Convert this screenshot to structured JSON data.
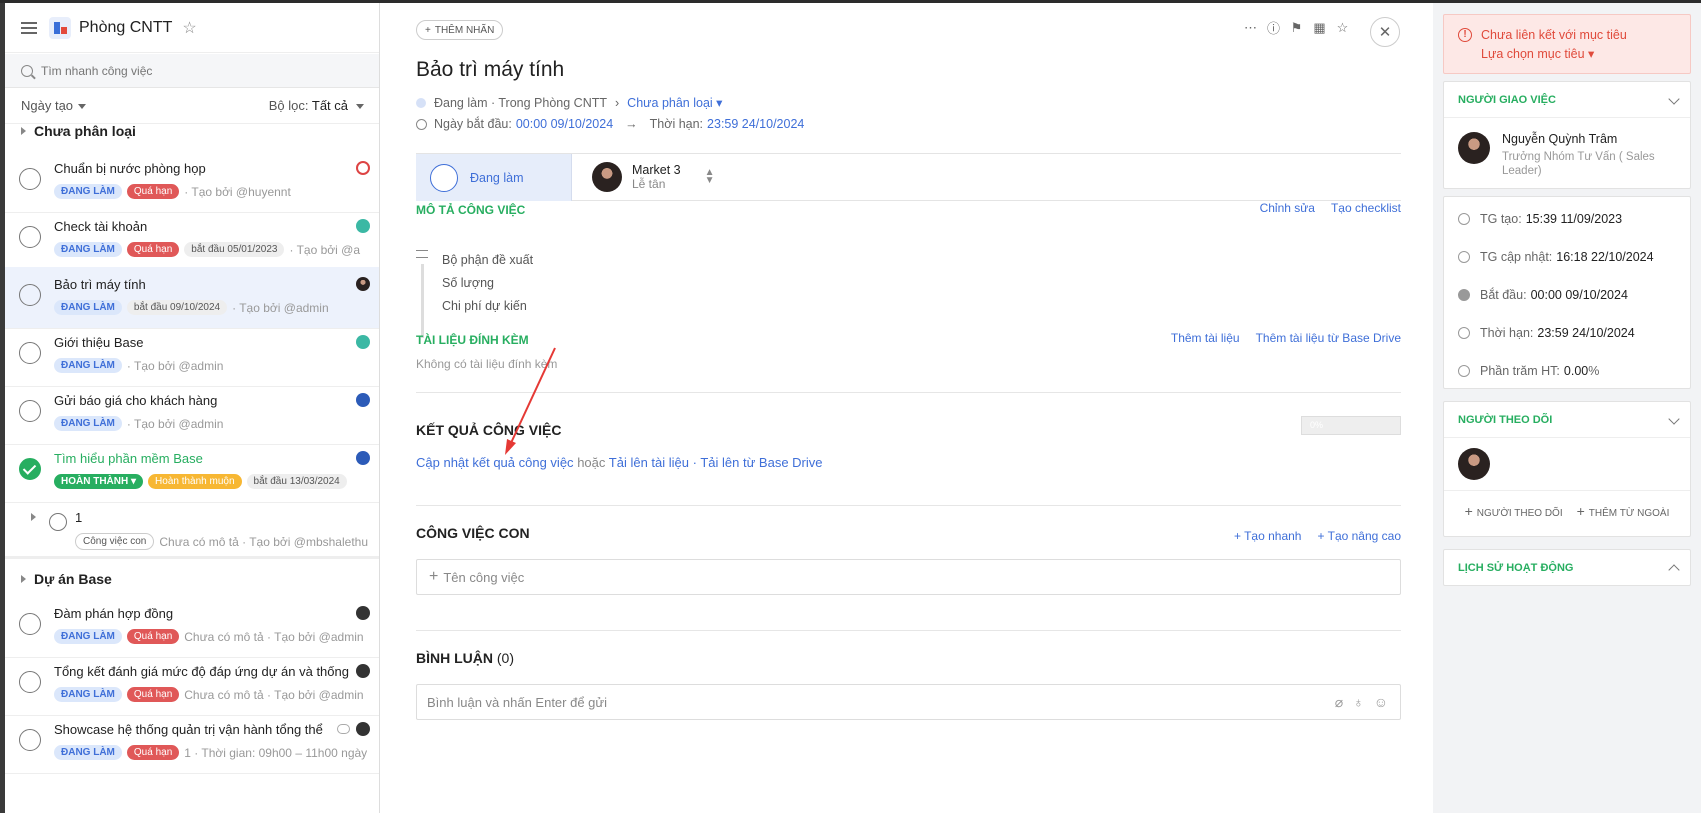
{
  "sidebar": {
    "project_title": "Phòng CNTT",
    "search_placeholder": "Tìm nhanh công việc",
    "sort_label": "Ngày tạo",
    "filter_label": "Bộ lọc:",
    "filter_value": "Tất cả",
    "groups": [
      {
        "title": "Chưa phân loại"
      },
      {
        "title": "Dự án Base"
      }
    ],
    "tasks": [
      {
        "name": "Chuẩn bị nước phòng họp",
        "badges": [
          "ĐANG LÀM",
          "Quá hạn"
        ],
        "meta": "· Tạo bởi @huyennt"
      },
      {
        "name": "Check tài khoản",
        "badges": [
          "ĐANG LÀM",
          "Quá hạn",
          "bắt đầu 05/01/2023"
        ],
        "meta": "· Tạo bởi @a"
      },
      {
        "name": "Bảo trì máy tính",
        "badges": [
          "ĐANG LÀM",
          "bắt đầu 09/10/2024"
        ],
        "meta": "· Tạo bởi @admin"
      },
      {
        "name": "Giới thiệu Base",
        "badges": [
          "ĐANG LÀM"
        ],
        "meta": "· Tạo bởi @admin"
      },
      {
        "name": "Gửi báo giá cho khách hàng",
        "badges": [
          "ĐANG LÀM"
        ],
        "meta": "· Tạo bởi @admin"
      },
      {
        "name": "Tìm hiểu phần mềm Base",
        "badges": [
          "HOÀN THÀNH",
          "Hoàn thành muộn",
          "bắt đầu 13/03/2024"
        ],
        "meta": ""
      },
      {
        "name": "1",
        "badges": [
          "Công việc con"
        ],
        "meta": "Chưa có mô tả · Tạo bởi @mbshalethu"
      },
      {
        "name": "Đàm phán hợp đồng",
        "badges": [
          "ĐANG LÀM",
          "Quá hạn"
        ],
        "meta": "Chưa có mô tả · Tạo bởi @admin"
      },
      {
        "name": "Tổng kết đánh giá mức độ đáp ứng dự án và thống",
        "badges": [
          "ĐANG LÀM",
          "Quá hạn"
        ],
        "meta": "Chưa có mô tả · Tạo bởi @admin"
      },
      {
        "name": "Showcase hệ thống quản trị vận hành tổng thể",
        "badges": [
          "ĐANG LÀM",
          "Quá hạn"
        ],
        "meta": "1 · Thời gian: 09h00 – 11h00 ngày"
      }
    ]
  },
  "detail": {
    "label_button": "THÊM NHÃN",
    "title": "Bảo trì máy tính",
    "status_line": "Đang làm · Trong Phòng CNTT",
    "category": "Chưa phân loại",
    "start_label": "Ngày bắt đầu:",
    "start_value": "00:00 09/10/2024",
    "due_label": "Thời hạn:",
    "due_value": "23:59 24/10/2024",
    "status": "Đang làm",
    "assignee_name": "Market 3",
    "assignee_role": "Lễ tân",
    "desc_title": "MÔ TẢ CÔNG VIỆC",
    "desc_edit": "Chỉnh sửa",
    "desc_checklist": "Tạo checklist",
    "desc_lines": [
      "Bộ phận đề xuất",
      "Số lượng",
      "Chi phí dự kiến"
    ],
    "attach_title": "TÀI LIỆU ĐÍNH KÈM",
    "attach_add": "Thêm tài liệu",
    "attach_drive": "Thêm tài liệu từ Base Drive",
    "attach_empty": "Không có tài liệu đính kèm",
    "result_title": "KẾT QUẢ CÔNG VIỆC",
    "result_progress": "0%",
    "result_update": "Cập nhật kết quả công việc",
    "result_or": "hoặc",
    "result_upload": "Tải lên tài liệu",
    "result_sep": "·",
    "result_drive": "Tải lên từ Base Drive",
    "sub_title": "CÔNG VIỆC CON",
    "sub_quick": "Tạo nhanh",
    "sub_advanced": "Tạo nâng cao",
    "sub_placeholder": "Tên công việc",
    "comment_title": "BÌNH LUẬN",
    "comment_count": "(0)",
    "comment_placeholder": "Bình luận và nhấn Enter để gửi"
  },
  "right": {
    "warn_text": "Chưa liên kết với mục tiêu",
    "warn_link": "Lựa chọn mục tiêu",
    "assigner_title": "NGƯỜI GIAO VIỆC",
    "assigner_name": "Nguyễn Quỳnh Trâm",
    "assigner_role": "Trưởng Nhóm Tư Vấn ( Sales Leader)",
    "info": [
      {
        "label": "TG tạo:",
        "value": "15:39 11/09/2023"
      },
      {
        "label": "TG cập nhật:",
        "value": "16:18 22/10/2024"
      },
      {
        "label": "Bắt đầu:",
        "value": "00:00 09/10/2024"
      },
      {
        "label": "Thời hạn:",
        "value": "23:59 24/10/2024"
      },
      {
        "label": "Phần trăm HT:",
        "value": "0.00",
        "suffix": "%"
      }
    ],
    "followers_title": "NGƯỜI THEO DÕI",
    "add_follower": "NGƯỜI THEO DÕI",
    "add_external": "THÊM TỪ NGOÀI",
    "history_title": "LỊCH SỬ HOẠT ĐỘNG"
  },
  "colors": {
    "accent": "#3f6fd8",
    "green": "#27ae60",
    "danger": "#e05858",
    "warning": "#f7b733"
  }
}
